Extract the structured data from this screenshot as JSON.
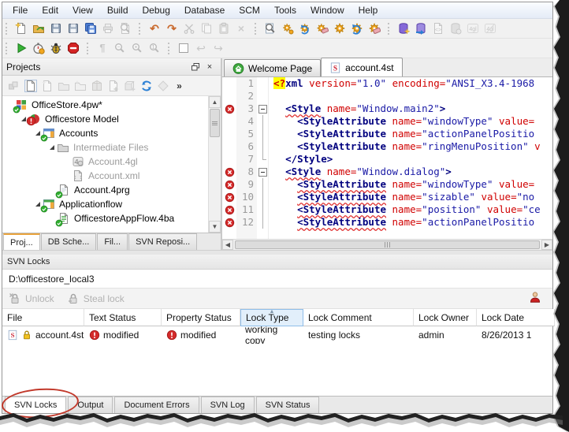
{
  "menu": {
    "items": [
      "File",
      "Edit",
      "View",
      "Build",
      "Debug",
      "Database",
      "SCM",
      "Tools",
      "Window",
      "Help"
    ]
  },
  "toolbars": {
    "main": [
      {
        "buttons": [
          {
            "name": "new-file"
          },
          {
            "name": "open-file"
          },
          {
            "name": "save"
          },
          {
            "name": "save-as"
          },
          {
            "name": "save-all"
          },
          {
            "name": "print",
            "disabled": true
          },
          {
            "name": "print-preview",
            "disabled": true
          }
        ]
      },
      {
        "buttons": [
          {
            "name": "undo"
          },
          {
            "name": "redo"
          },
          {
            "name": "cut",
            "disabled": true
          },
          {
            "name": "copy",
            "disabled": true
          },
          {
            "name": "paste",
            "disabled": true
          },
          {
            "name": "delete",
            "disabled": true
          }
        ]
      },
      {
        "buttons": [
          {
            "name": "search-document"
          },
          {
            "name": "build"
          },
          {
            "name": "rebuild"
          },
          {
            "name": "clean"
          },
          {
            "name": "build-all"
          },
          {
            "name": "rebuild-all"
          },
          {
            "name": "clean-all"
          }
        ]
      },
      {
        "buttons": [
          {
            "name": "new-database"
          },
          {
            "name": "import-database"
          },
          {
            "name": "generate-code",
            "disabled": true
          },
          {
            "name": "database-schema",
            "disabled": true
          },
          {
            "name": "compile-4gl",
            "disabled": true
          },
          {
            "name": "link-4gl",
            "disabled": true
          }
        ]
      }
    ],
    "run": [
      {
        "buttons": [
          {
            "name": "run"
          },
          {
            "name": "profile"
          },
          {
            "name": "debug"
          },
          {
            "name": "stop"
          }
        ]
      },
      {
        "buttons": [
          {
            "name": "paragraph",
            "disabled": true
          },
          {
            "name": "zoom-out",
            "disabled": true
          },
          {
            "name": "zoom-in",
            "disabled": true
          },
          {
            "name": "zoom-100",
            "disabled": true
          }
        ]
      },
      {
        "buttons": [
          {
            "name": "form-frame"
          },
          {
            "name": "nav-back",
            "disabled": true
          },
          {
            "name": "nav-forward",
            "disabled": true
          }
        ]
      }
    ]
  },
  "projects": {
    "title": "Projects",
    "toolbar": [
      {
        "name": "project-group",
        "disabled": true
      },
      {
        "name": "new-file-project"
      },
      {
        "name": "new-virtual-folder",
        "disabled": true
      },
      {
        "name": "open-folder",
        "disabled": true
      },
      {
        "name": "new-group",
        "disabled": true
      },
      {
        "name": "package",
        "disabled": true
      },
      {
        "name": "add-file",
        "disabled": true
      },
      {
        "name": "add-library",
        "disabled": true
      },
      {
        "name": "refresh"
      },
      {
        "name": "compare",
        "disabled": true
      },
      {
        "name": "overflow"
      }
    ],
    "tree": [
      {
        "label": "OfficeStore.4pw*",
        "level": 0,
        "icon": "project",
        "overlay": "check",
        "arrow": false
      },
      {
        "label": "Officestore Model",
        "level": 1,
        "icon": "model",
        "overlay": "error",
        "arrow": true
      },
      {
        "label": "Accounts",
        "level": 2,
        "icon": "folder-app",
        "overlay": "check",
        "arrow": true
      },
      {
        "label": "Intermediate Files",
        "level": 3,
        "icon": "folder-gray",
        "overlay": null,
        "arrow": true,
        "dim": true
      },
      {
        "label": "Account.4gl",
        "level": 4,
        "icon": "file-4gl",
        "overlay": null,
        "arrow": false,
        "dim": true
      },
      {
        "label": "Account.xml",
        "level": 4,
        "icon": "file-xml",
        "overlay": null,
        "arrow": false,
        "dim": true
      },
      {
        "label": "Account.4prg",
        "level": 3,
        "icon": "file-prg",
        "overlay": "check",
        "arrow": false
      },
      {
        "label": "Applicationflow",
        "level": 2,
        "icon": "folder-app2",
        "overlay": "check",
        "arrow": true
      },
      {
        "label": "OfficestoreAppFlow.4ba",
        "level": 3,
        "icon": "file-4ba",
        "overlay": "check",
        "arrow": false
      }
    ],
    "tabs": {
      "items": [
        "Proj...",
        "DB Sche...",
        "Fil...",
        "SVN Reposi..."
      ],
      "active": 0
    }
  },
  "editor": {
    "tabs": [
      {
        "label": "Welcome Page",
        "icon": "home"
      },
      {
        "label": "account.4st",
        "icon": "s-file"
      }
    ],
    "active_tab": 1,
    "code": {
      "error_lines": [
        3,
        8,
        9,
        10,
        11,
        12
      ],
      "lines": [
        {
          "n": 1,
          "fold": "",
          "seg": [
            [
              "x",
              "<?"
            ],
            [
              "t",
              "xml"
            ],
            [
              "p",
              " "
            ],
            [
              "a",
              "version="
            ],
            [
              "s",
              "\"1.0\""
            ],
            [
              "p",
              " "
            ],
            [
              "a",
              "encoding="
            ],
            [
              "s",
              "\"ANSI_X3.4-1968"
            ]
          ]
        },
        {
          "n": 2,
          "fold": "",
          "seg": []
        },
        {
          "n": 3,
          "fold": "box",
          "seg": [
            [
              "p",
              "  "
            ],
            [
              "tq",
              "<Style"
            ],
            [
              "p",
              " "
            ],
            [
              "a",
              "name="
            ],
            [
              "s",
              "\"Window.main2\""
            ],
            [
              "t",
              ">"
            ]
          ]
        },
        {
          "n": 4,
          "fold": "line",
          "seg": [
            [
              "p",
              "    "
            ],
            [
              "t",
              "<StyleAttribute"
            ],
            [
              "p",
              " "
            ],
            [
              "a",
              "name="
            ],
            [
              "s",
              "\"windowType\""
            ],
            [
              "p",
              " "
            ],
            [
              "a",
              "value="
            ]
          ]
        },
        {
          "n": 5,
          "fold": "line",
          "seg": [
            [
              "p",
              "    "
            ],
            [
              "t",
              "<StyleAttribute"
            ],
            [
              "p",
              " "
            ],
            [
              "a",
              "name="
            ],
            [
              "s",
              "\"actionPanelPositio"
            ]
          ]
        },
        {
          "n": 6,
          "fold": "line",
          "seg": [
            [
              "p",
              "    "
            ],
            [
              "t",
              "<StyleAttribute"
            ],
            [
              "p",
              " "
            ],
            [
              "a",
              "name="
            ],
            [
              "s",
              "\"ringMenuPosition\""
            ],
            [
              "p",
              " "
            ],
            [
              "a",
              "v"
            ]
          ]
        },
        {
          "n": 7,
          "fold": "end",
          "seg": [
            [
              "p",
              "  "
            ],
            [
              "t",
              "</Style>"
            ]
          ]
        },
        {
          "n": 8,
          "fold": "box",
          "seg": [
            [
              "p",
              "  "
            ],
            [
              "tq",
              "<Style"
            ],
            [
              "p",
              " "
            ],
            [
              "a",
              "name="
            ],
            [
              "s",
              "\"Window.dialog\""
            ],
            [
              "t",
              ">"
            ]
          ]
        },
        {
          "n": 9,
          "fold": "line",
          "seg": [
            [
              "p",
              "    "
            ],
            [
              "tq",
              "<StyleAttribute"
            ],
            [
              "p",
              " "
            ],
            [
              "a",
              "name="
            ],
            [
              "s",
              "\"windowType\""
            ],
            [
              "p",
              " "
            ],
            [
              "a",
              "value="
            ]
          ]
        },
        {
          "n": 10,
          "fold": "line",
          "seg": [
            [
              "p",
              "    "
            ],
            [
              "tq",
              "<StyleAttribute"
            ],
            [
              "p",
              " "
            ],
            [
              "a",
              "name="
            ],
            [
              "s",
              "\"sizable\""
            ],
            [
              "p",
              " "
            ],
            [
              "a",
              "value="
            ],
            [
              "s",
              "\"no"
            ]
          ]
        },
        {
          "n": 11,
          "fold": "line",
          "seg": [
            [
              "p",
              "    "
            ],
            [
              "tq",
              "<StyleAttribute"
            ],
            [
              "p",
              " "
            ],
            [
              "a",
              "name="
            ],
            [
              "s",
              "\"position\""
            ],
            [
              "p",
              " "
            ],
            [
              "a",
              "value="
            ],
            [
              "s",
              "\"ce"
            ]
          ]
        },
        {
          "n": 12,
          "fold": "line",
          "seg": [
            [
              "p",
              "    "
            ],
            [
              "tq",
              "<StyleAttribute"
            ],
            [
              "p",
              " "
            ],
            [
              "a",
              "name="
            ],
            [
              "s",
              "\"actionPanelPositio"
            ]
          ]
        }
      ]
    }
  },
  "svn": {
    "title": "SVN Locks",
    "path": "D:\\officestore_local3",
    "buttons": [
      {
        "label": "Unlock",
        "icon": "unlock",
        "disabled": true
      },
      {
        "label": "Steal lock",
        "icon": "steal-lock",
        "disabled": true
      }
    ],
    "person_icon": "person",
    "table": {
      "columns": [
        "File",
        "Text Status",
        "Property Status",
        "Lock Type",
        "Lock Comment",
        "Lock Owner",
        "Lock Date"
      ],
      "widths": [
        104,
        98,
        100,
        80,
        140,
        80,
        99
      ],
      "sort": {
        "column": "Lock Type",
        "dir": "asc"
      },
      "rows": [
        {
          "file": "account.4st",
          "file_icons": [
            "s-file",
            "lock"
          ],
          "cells": [
            {
              "icon": null,
              "text": ""
            },
            {
              "icon": "warn",
              "text": "modified"
            },
            {
              "icon": "warn",
              "text": "modified"
            },
            {
              "icon": null,
              "text": "working copy"
            },
            {
              "icon": null,
              "text": "testing locks"
            },
            {
              "icon": null,
              "text": "admin"
            },
            {
              "icon": null,
              "text": "8/26/2013 1"
            }
          ]
        }
      ]
    }
  },
  "bottom_tabs": {
    "items": [
      "SVN Locks",
      "Output",
      "Document Errors",
      "SVN Log",
      "SVN Status"
    ],
    "active": 0,
    "annotation": "red-ellipse-around-active-tab"
  },
  "colors": {
    "tag": "#00007f",
    "attribute": "#d00000",
    "string": "#1a1aa6",
    "xml_decl_highlight": "#ffff00",
    "error": "#d42a2a",
    "check": "#2fae2f",
    "accent_blue": "#2a7fd4",
    "sorted_header_bg": "#e2effb"
  }
}
